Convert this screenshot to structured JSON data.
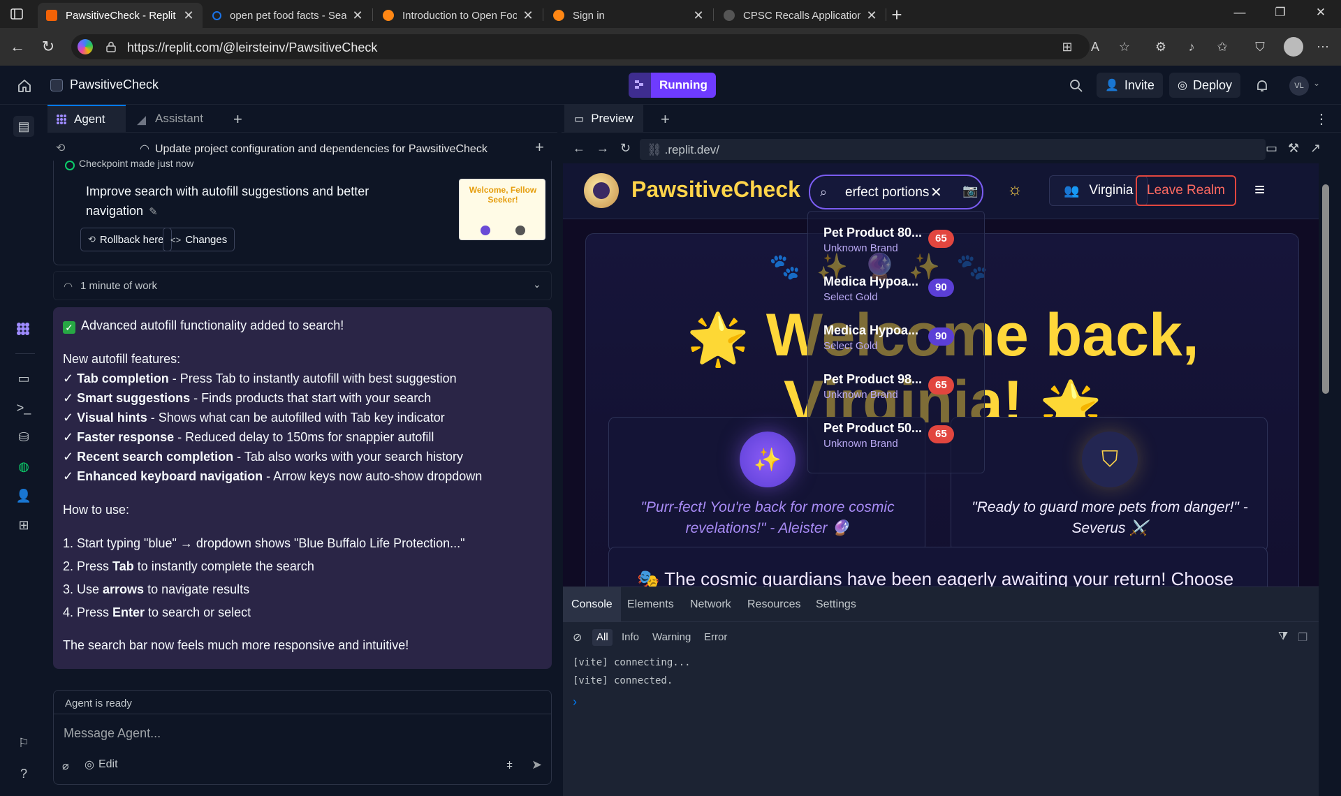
{
  "browser": {
    "tabs": [
      {
        "title": "PawsitiveCheck - Replit",
        "active": true,
        "color": "#f26207"
      },
      {
        "title": "open pet food facts - Search",
        "active": false,
        "color": "#1a73e8"
      },
      {
        "title": "Introduction to Open Food Facts /",
        "active": false,
        "color": "#ff8714"
      },
      {
        "title": "Sign in",
        "active": false,
        "color": "#ff8714"
      },
      {
        "title": "CPSC Recalls Application Program",
        "active": false,
        "color": "#555555"
      }
    ],
    "url": "https://replit.com/@leirsteinv/PawsitiveCheck"
  },
  "replit": {
    "project_name": "PawsitiveCheck",
    "run_label": "Running",
    "invite_label": "Invite",
    "deploy_label": "Deploy",
    "avatar_initials": "VL",
    "accent": "#6e3bff"
  },
  "agent": {
    "tabs": [
      "Agent",
      "Assistant"
    ],
    "checkpoint_bar_title": "Update project configuration and dependencies for PawsitiveCheck",
    "checkpoint_made": "Checkpoint made just now",
    "checkpoint_message": "Improve search with autofill suggestions and better navigation",
    "rollback_label": "Rollback here",
    "changes_label": "Changes",
    "thumbnail_text": "Welcome, Fellow Seeker!",
    "work_summary": "1 minute of work",
    "response": {
      "headline": "Advanced autofill functionality added to search!",
      "features_title": "New autofill features:",
      "features": [
        {
          "bold": "Tab completion",
          "text": " - Press Tab to instantly autofill with best suggestion"
        },
        {
          "bold": "Smart suggestions",
          "text": " - Finds products that start with your search"
        },
        {
          "bold": "Visual hints",
          "text": " - Shows what can be autofilled with Tab key indicator"
        },
        {
          "bold": "Faster response",
          "text": " - Reduced delay to 150ms for snappier autofill"
        },
        {
          "bold": "Recent search completion",
          "text": " - Tab also works with your search history"
        },
        {
          "bold": "Enhanced keyboard navigation",
          "text": " - Arrow keys now auto-show dropdown"
        }
      ],
      "howto_title": "How to use:",
      "steps": [
        {
          "pre": "1. Start typing \"blue\" → dropdown shows \"Blue Buffalo Life Protection...\"",
          "bold": "",
          "post": ""
        },
        {
          "pre": "2. Press ",
          "bold": "Tab",
          "post": " to instantly complete the search"
        },
        {
          "pre": "3. Use ",
          "bold": "arrows",
          "post": " to navigate results"
        },
        {
          "pre": "4. Press ",
          "bold": "Enter",
          "post": " to search or select"
        }
      ],
      "closing": "The search bar now feels much more responsive and intuitive!"
    },
    "status": "Agent is ready",
    "message_placeholder": "Message Agent...",
    "edit_label": "Edit"
  },
  "preview": {
    "tab_label": "Preview",
    "url": ".replit.dev/",
    "site": {
      "brand": "PawsitiveCheck",
      "search_value": "erfect portions",
      "user_label": "Virginia",
      "leave_label": "Leave Realm",
      "hero_line1": "Welcome back,",
      "hero_line2": "Virginia!",
      "quotes": [
        {
          "text": "\"Purr-fect! You're back for more cosmic revelations!\" - Aleister 🔮",
          "color": "#a88bf5"
        },
        {
          "text": "\"Ready to guard more pets from danger!\" - Severus ⚔️",
          "color": "#f0ecff"
        }
      ],
      "awaiting_text": "🎭 The cosmic guardians have been eagerly awaiting your return! Choose",
      "suggestions": [
        {
          "name": "Pet Product 80...",
          "brand": "Unknown Brand",
          "score": "65",
          "score_color": "#e2463f"
        },
        {
          "name": "Medica Hypoa...",
          "brand": "Select Gold",
          "score": "90",
          "score_color": "#5b3fd6"
        },
        {
          "name": "Medica Hypoa...",
          "brand": "Select Gold",
          "score": "90",
          "score_color": "#5b3fd6"
        },
        {
          "name": "Pet Product 98...",
          "brand": "Unknown Brand",
          "score": "65",
          "score_color": "#e2463f"
        },
        {
          "name": "Pet Product 50...",
          "brand": "Unknown Brand",
          "score": "65",
          "score_color": "#e2463f"
        }
      ]
    },
    "devtools": {
      "tabs": [
        "Console",
        "Elements",
        "Network",
        "Resources",
        "Settings"
      ],
      "filters": [
        "All",
        "Info",
        "Warning",
        "Error"
      ],
      "logs": [
        "[vite] connecting...",
        "[vite] connected."
      ]
    }
  }
}
